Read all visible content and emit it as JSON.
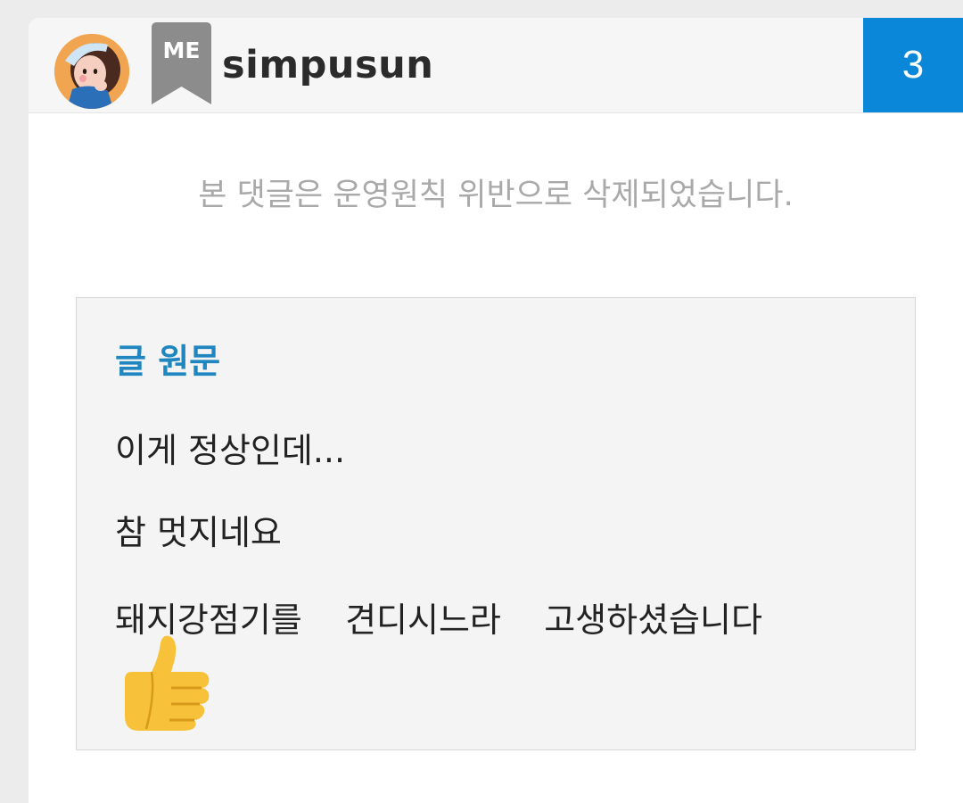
{
  "comment": {
    "username": "simpusun",
    "me_badge": "ME",
    "count": "3",
    "deleted_message": "본 댓글은 운영원칙 위반으로 삭제되었습니다."
  },
  "original": {
    "title": "글 원문",
    "lines": [
      "이게 정상인데...",
      "참 멋지네요",
      "돼지강점기를    견디시느라    고생하셨습니다"
    ],
    "emoji": "thumbs-up-emoji"
  },
  "colors": {
    "accent_blue": "#0a87d8",
    "title_blue": "#1f86bf",
    "muted_text": "#a9a9a9",
    "badge_gray": "#8c8c8c"
  }
}
